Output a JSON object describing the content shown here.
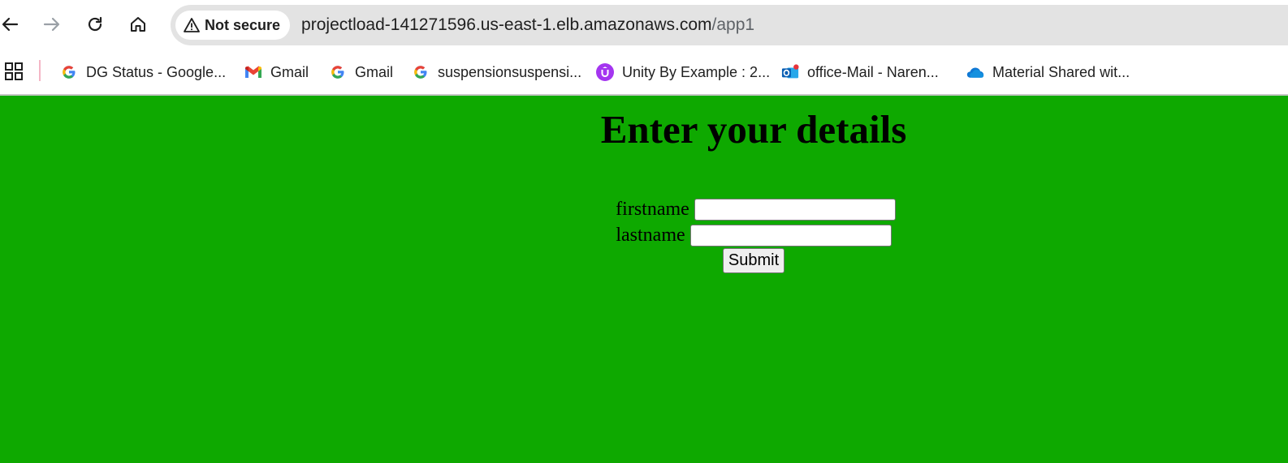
{
  "browser": {
    "security_label": "Not secure",
    "url_host": "projectload-141271596.us-east-1.elb.amazonaws.com",
    "url_path": "/app1",
    "bookmarks": [
      {
        "label": "DG Status - Google...",
        "icon": "google-icon"
      },
      {
        "label": "Gmail",
        "icon": "gmail-icon"
      },
      {
        "label": "Gmail",
        "icon": "google-icon"
      },
      {
        "label": "suspensionsuspensi...",
        "icon": "google-icon"
      },
      {
        "label": "Unity By Example : 2...",
        "icon": "udemy-icon"
      },
      {
        "label": "office-Mail - Naren...",
        "icon": "outlook-icon"
      },
      {
        "label": "Material Shared wit...",
        "icon": "onedrive-icon"
      }
    ]
  },
  "page": {
    "title": "Enter your details",
    "background_color": "#0ea900",
    "form": {
      "firstname_label": "firstname",
      "firstname_value": "",
      "lastname_label": "lastname",
      "lastname_value": "",
      "submit_label": "Submit"
    }
  }
}
